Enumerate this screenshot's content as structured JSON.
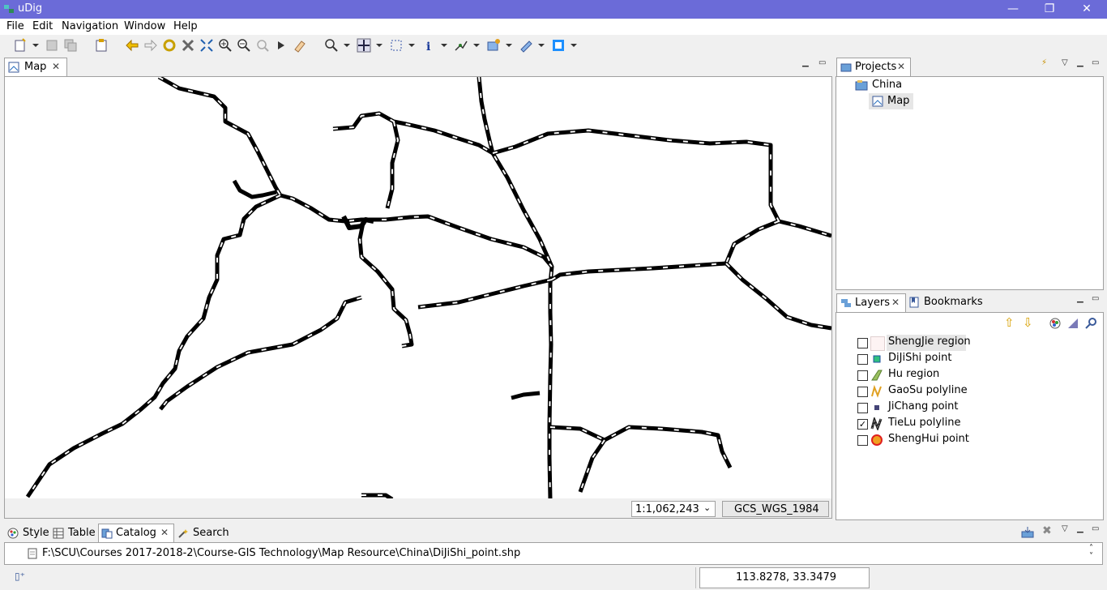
{
  "window": {
    "title": "uDig",
    "minimize": "—",
    "restore": "❐",
    "close": "✕"
  },
  "menu": [
    "File",
    "Edit",
    "Navigation",
    "Window",
    "Help"
  ],
  "map_tab": {
    "label": "Map"
  },
  "scale": {
    "value": "1:1,062,243"
  },
  "crs": {
    "value": "GCS_WGS_1984"
  },
  "projects": {
    "tab_label": "Projects",
    "tree": {
      "project": "China",
      "map": "Map"
    }
  },
  "layers": {
    "tab_label": "Layers",
    "bookmarks_label": "Bookmarks",
    "items": [
      {
        "label": "ShengJie region",
        "checked": false,
        "icon": "region-swatch-icon"
      },
      {
        "label": "DiJiShi point",
        "checked": false,
        "icon": "point-square-icon"
      },
      {
        "label": "Hu region",
        "checked": false,
        "icon": "polygon-green-icon"
      },
      {
        "label": "GaoSu polyline",
        "checked": false,
        "icon": "line-orange-icon"
      },
      {
        "label": "JiChang point",
        "checked": false,
        "icon": "point-dark-icon"
      },
      {
        "label": "TieLu polyline",
        "checked": true,
        "icon": "line-black-icon"
      },
      {
        "label": "ShengHui point",
        "checked": false,
        "icon": "point-red-circle-icon"
      }
    ]
  },
  "bottom_tabs": {
    "style": "Style",
    "table": "Table",
    "catalog": "Catalog",
    "search": "Search"
  },
  "catalog_path": "F:\\SCU\\Courses 2017-2018-2\\Course-GIS Technology\\Map Resource\\China\\DiJiShi_point.shp",
  "status": {
    "coordinates": "113.8278, 33.3479"
  },
  "colors": {
    "titlebar": "#6b6bd8",
    "selection": "#e6e6e6"
  }
}
